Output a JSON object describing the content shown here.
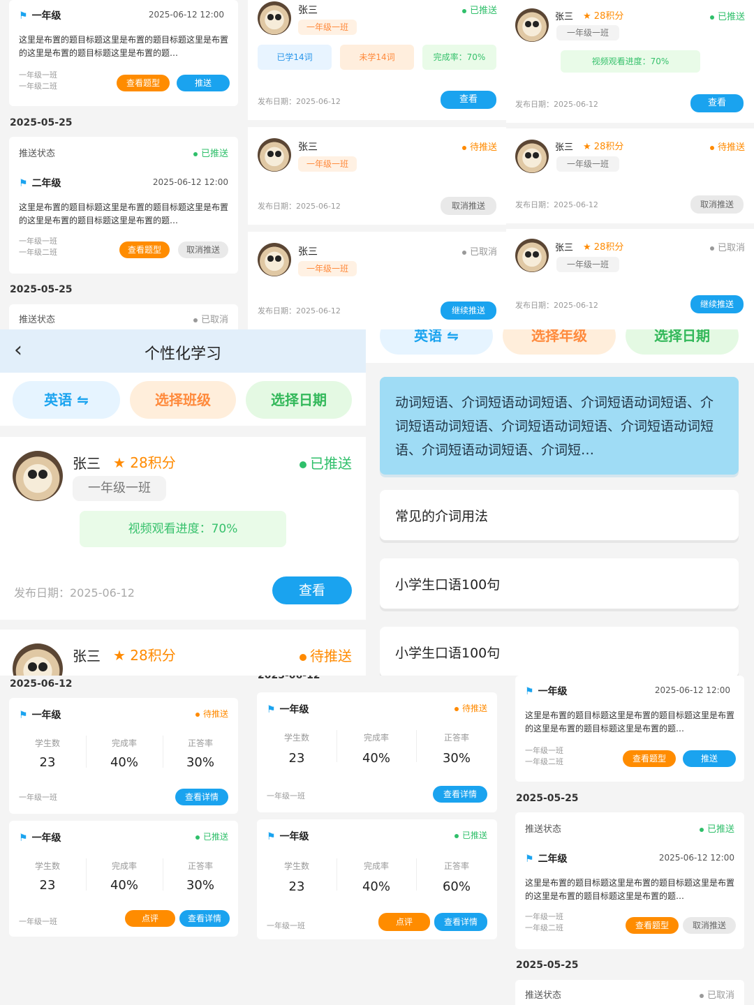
{
  "common": {
    "name": "张三",
    "points": "28积分",
    "class_tag": "一年级一班",
    "publish": "发布日期：2025-06-12",
    "view": "查看",
    "cancel_push": "取消推送",
    "continue_push": "继续推送",
    "status_pushed": "已推送",
    "status_pending": "待推送",
    "status_cancelled": "已取消",
    "learned": "已学14词",
    "unlearned": "未学14词",
    "completion": "完成率：70%",
    "video_progress": "视频观看进度：70%"
  },
  "assign": {
    "grade1": "一年级",
    "grade2": "二年级",
    "datetime": "2025-06-12 12:00",
    "desc": "这里是布置的题目标题这里是布置的题目标题这里是布置的这里是布置的题目标题这里是布置的题…",
    "class1": "一年级一班",
    "class2": "一年级二班",
    "view_types": "查看题型",
    "push": "推送",
    "cancel_push": "取消推送",
    "date_header": "2025-05-25",
    "push_status_label": "推送状态"
  },
  "stats": {
    "date_header": "2025-06-12",
    "date_header_cut": "2025-06-12",
    "students_label": "学生数",
    "completion_label": "完成率",
    "accuracy_label": "正答率",
    "students": "23",
    "completion": "40%",
    "accuracy1": "30%",
    "accuracy2": "60%",
    "details": "查看详情",
    "comment": "点评"
  },
  "main": {
    "title": "个性化学习",
    "subject": "英语",
    "select_class": "选择班级",
    "select_grade": "选择年级",
    "select_date": "选择日期",
    "name": "张三",
    "points": "28积分",
    "class_tag": "一年级一班",
    "status": "已推送",
    "status2": "待推送",
    "video_progress": "视频观看进度：70%",
    "publish": "发布日期：2025-06-12",
    "view": "查看"
  },
  "lessons": {
    "featured": "动词短语、介词短语动词短语、介词短语动词短语、介词短语动词短语、介词短语动词短语、介词短语动词短语、介词短语动词短语、介词短…",
    "items": [
      "常见的介词用法",
      "小学生口语100句",
      "小学生口语100句"
    ]
  },
  "colors": {
    "accent_blue": "#1aa3ef",
    "accent_orange": "#ff8c00",
    "status_green": "#2fbf6a",
    "header_bg": "#e2effa",
    "featured_bg": "#9fdcf5"
  }
}
